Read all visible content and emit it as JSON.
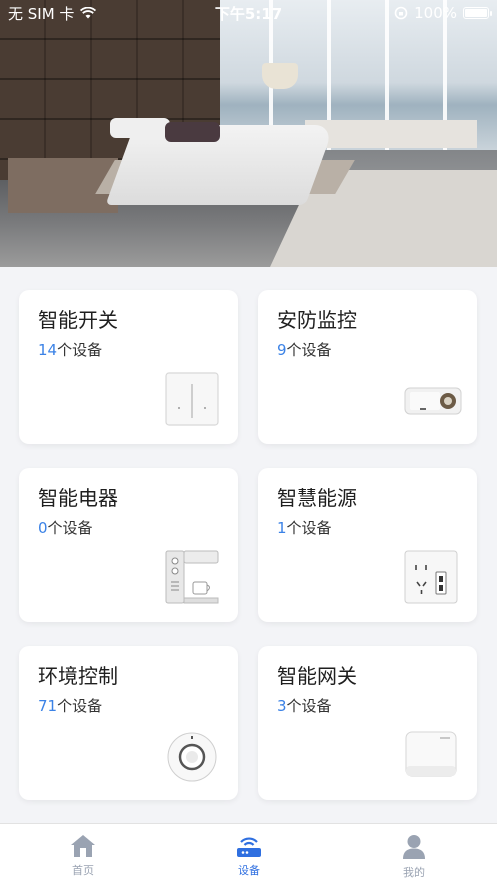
{
  "status_bar": {
    "carrier": "无 SIM 卡",
    "time": "下午5:17",
    "battery": "100%"
  },
  "cards": [
    {
      "title": "智能开关",
      "count": "14",
      "unit": "个设备",
      "icon": "smart-switch-icon"
    },
    {
      "title": "安防监控",
      "count": "9",
      "unit": "个设备",
      "icon": "doorbell-camera-icon"
    },
    {
      "title": "智能电器",
      "count": "0",
      "unit": "个设备",
      "icon": "coffee-machine-icon"
    },
    {
      "title": "智慧能源",
      "count": "1",
      "unit": "个设备",
      "icon": "wall-socket-icon"
    },
    {
      "title": "环境控制",
      "count": "71",
      "unit": "个设备",
      "icon": "sensor-icon"
    },
    {
      "title": "智能网关",
      "count": "3",
      "unit": "个设备",
      "icon": "gateway-icon"
    }
  ],
  "tabbar": {
    "tabs": [
      {
        "label": "首页",
        "icon": "home-icon",
        "active": false
      },
      {
        "label": "设备",
        "icon": "router-icon",
        "active": true
      },
      {
        "label": "我的",
        "icon": "user-icon",
        "active": false
      }
    ]
  },
  "colors": {
    "accent": "#3b82e6",
    "tab_active": "#2f6fe0",
    "tab_inactive": "#9aa3b2",
    "background": "#f3f4f7"
  }
}
